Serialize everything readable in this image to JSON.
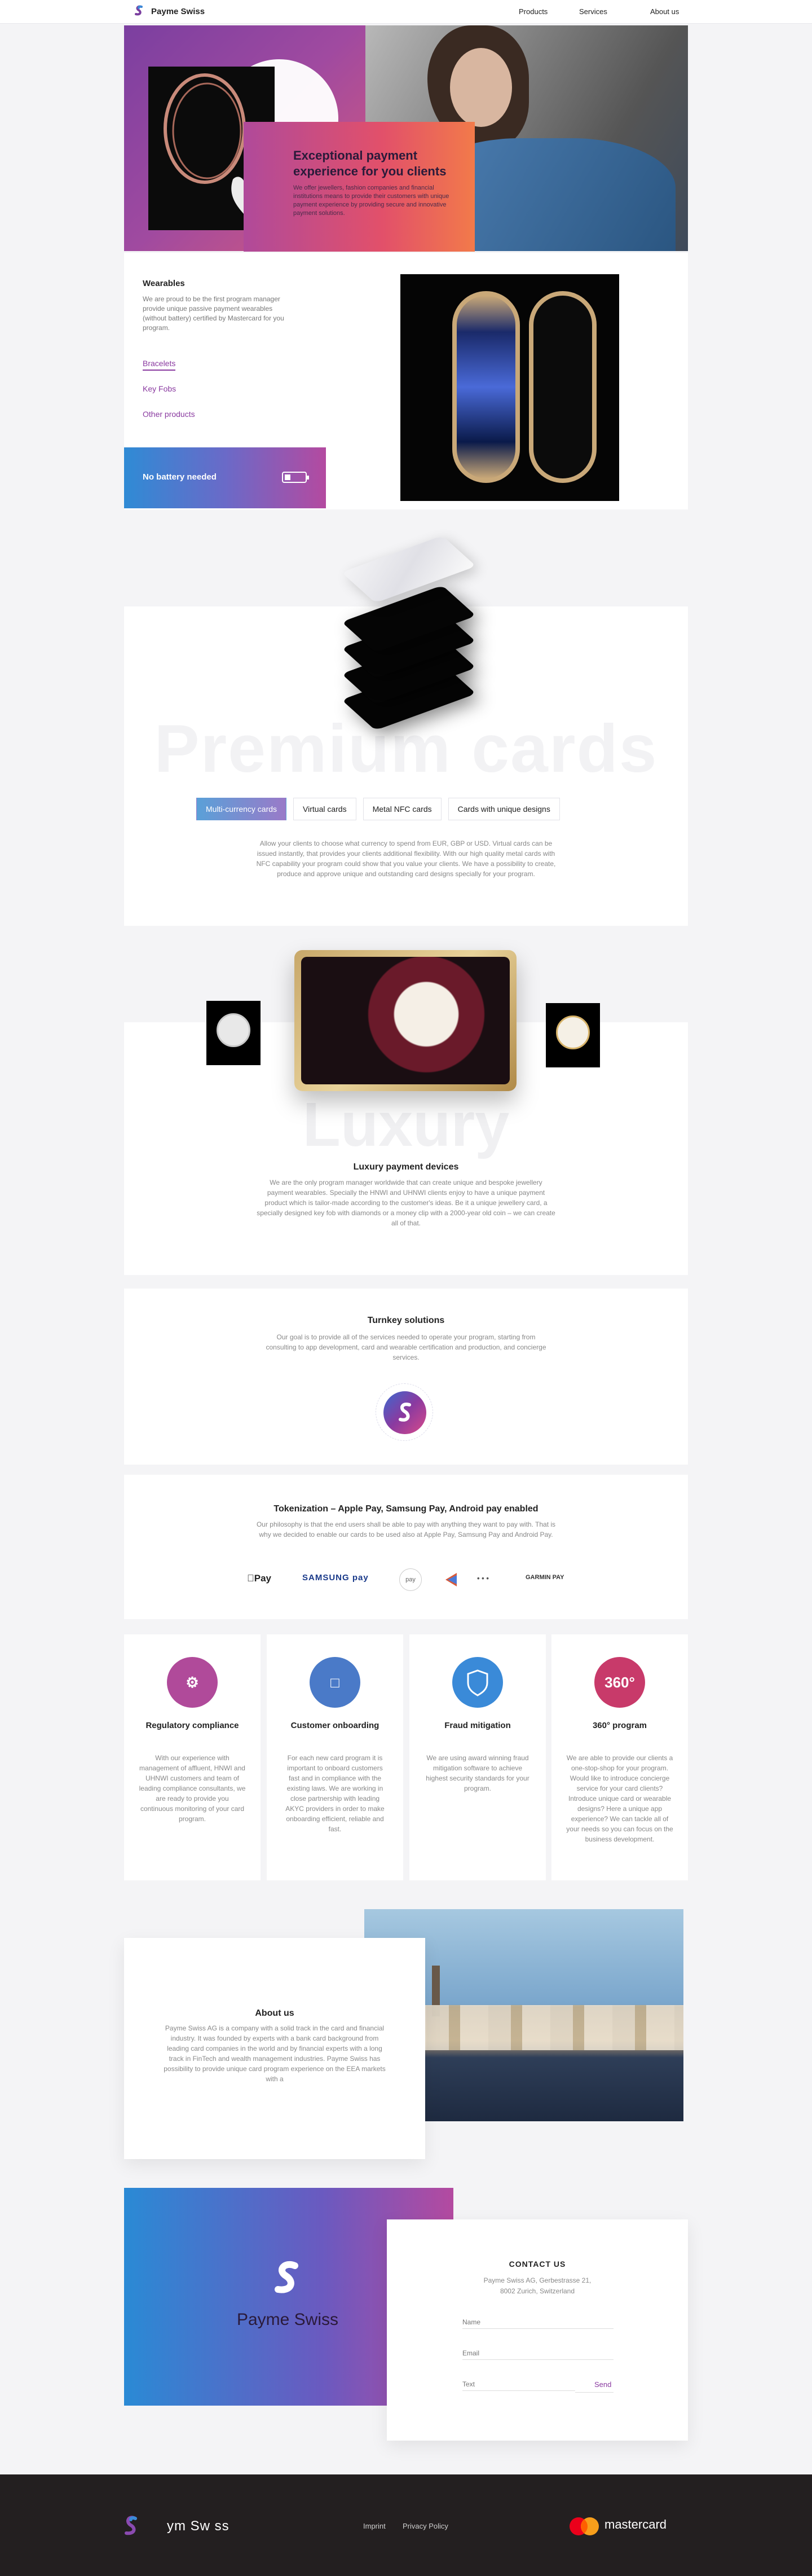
{
  "header": {
    "brand": "Payme Swiss",
    "nav": [
      "Products",
      "Services",
      "About us"
    ]
  },
  "hero": {
    "title": "Exceptional payment experience for you clients",
    "description": "We offer jewellers, fashion companies and financial institutions means to provide their customers with unique payment experience by providing secure and innovative payment solutions."
  },
  "wearables": {
    "title": "Wearables",
    "description": "We are proud to be the first program manager provide unique passive payment wearables (without battery) certified by Mastercard for you program.",
    "links": [
      "Bracelets",
      "Key Fobs",
      "Other products"
    ],
    "battery_text": "No battery needed"
  },
  "premium": {
    "watermark": "Premium cards",
    "tabs": [
      "Multi-currency cards",
      "Virtual cards",
      "Metal NFC cards",
      "Cards with unique designs"
    ],
    "description": "Allow your clients to choose what currency to spend from EUR, GBP or USD. Virtual cards can be issued instantly, that provides your clients additional flexibility. With our high quality metal cards with NFC capability your program could show that you value your clients. We have a possibility to create, produce and approve unique and outstanding card designs specially for your program."
  },
  "luxury": {
    "watermark": "Luxury",
    "title": "Luxury payment devices",
    "description": "We are the only program manager worldwide that can create unique and bespoke jewellery payment wearables. Specially the HNWI and UHNWI clients enjoy to have a unique payment product which is tailor-made according to the customer's ideas. Be it a unique jewellery card, a specially designed key fob with diamonds or a money clip with a 2000-year old coin – we can create all of that."
  },
  "turnkey": {
    "title": "Turnkey solutions",
    "description": "Our goal is to provide all of the services needed to operate your program, starting from consulting to app development, card and wearable certification and production, and concierge services."
  },
  "tokenization": {
    "title": "Tokenization – Apple Pay, Samsung Pay, Android pay enabled",
    "description": "Our philosophy is that the end users shall be able to pay with anything they want to pay with. That is why we decided to enable our cards to be used also at Apple Pay, Samsung Pay and Android Pay.",
    "logos": [
      "Pay",
      "SAMSUNG pay",
      "pay",
      "",
      "• • •",
      "GARMIN PAY"
    ]
  },
  "features": [
    {
      "icon": "gears-icon",
      "color": "#b04a9a",
      "title": "Regulatory compliance",
      "text": "With our experience with management of affluent, HNWI and UHNWI customers and team of leading compliance consultants, we are ready to provide you continuous monitoring of your card program."
    },
    {
      "icon": "presentation-icon",
      "color": "#4a7ac8",
      "title": "Customer onboarding",
      "text": "For each new card program it is important to onboard customers fast and in compliance with the existing laws. We are working in close partnership with leading AKYC providers in order to make onboarding efficient, reliable and fast."
    },
    {
      "icon": "shield-icon",
      "color": "#3a8ad8",
      "title": "Fraud mitigation",
      "text": "We are using award winning fraud mitigation software to achieve highest security standards for your program."
    },
    {
      "icon": "360-icon",
      "icon_text": "360°",
      "color": "#c83a6a",
      "title": "360° program",
      "text": "We are able to provide our clients a one-stop-shop for your program. Would like to introduce concierge service for your card clients? Introduce unique card or wearable designs? Here a unique app experience? We can tackle all of your needs so you can focus on the business development."
    }
  ],
  "about": {
    "title": "About us",
    "description": "Payme Swiss AG is a company with a solid track in the card and financial industry. It was founded by experts with a bank card background from leading card companies in the world and by financial experts with a long track in FinTech and wealth management industries. Payme Swiss has possibility to provide unique card program experience on the EEA markets with a"
  },
  "contact": {
    "brand": "Payme Swiss",
    "title": "CONTACT US",
    "address_line1": "Payme Swiss AG, Gerbestrasse 21,",
    "address_line2": "8002 Zurich, Switzerland",
    "name_placeholder": "Name",
    "email_placeholder": "Email",
    "text_placeholder": "Text",
    "send_label": "Send"
  },
  "footer": {
    "brand": "ym  Sw ss",
    "links": [
      "Imprint",
      "Privacy Policy"
    ],
    "mastercard": "mastercard"
  }
}
